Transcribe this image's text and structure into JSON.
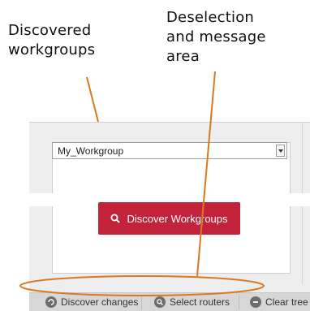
{
  "annotations": {
    "discovered_workgroups": [
      "Discovered",
      "workgroups"
    ],
    "deselection_area": [
      "Deselection",
      "and message",
      "area"
    ],
    "colors": {
      "pointer": "#d97a1e",
      "ellipse": "#d97a1e"
    }
  },
  "panel": {
    "workgroup_select": {
      "value": "My_Workgroup"
    },
    "discover_button": {
      "label": "Discover Workgroups",
      "icon": "search-icon",
      "color": "#c2223a"
    }
  },
  "bottom_bar": {
    "items": [
      {
        "label": "Discover changes",
        "icon": "refresh-icon"
      },
      {
        "label": "Select routers",
        "icon": "select-icon"
      },
      {
        "label": "Clear tree",
        "icon": "minus-circle-icon"
      }
    ]
  }
}
